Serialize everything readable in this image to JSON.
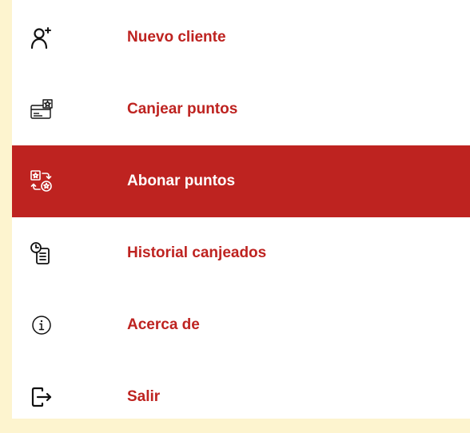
{
  "colors": {
    "background": "#FDF4CF",
    "panel": "#FFFFFF",
    "accent": "#BE2320",
    "icon": "#111111",
    "active_text": "#FFFFFF"
  },
  "menu": {
    "items": [
      {
        "label": "Nuevo cliente",
        "icon": "add-user-icon",
        "active": false
      },
      {
        "label": "Canjear puntos",
        "icon": "redeem-card-icon",
        "active": false
      },
      {
        "label": "Abonar puntos",
        "icon": "exchange-points-icon",
        "active": true
      },
      {
        "label": "Historial canjeados",
        "icon": "history-list-icon",
        "active": false
      },
      {
        "label": "Acerca de",
        "icon": "info-icon",
        "active": false
      },
      {
        "label": "Salir",
        "icon": "logout-icon",
        "active": false
      }
    ]
  }
}
